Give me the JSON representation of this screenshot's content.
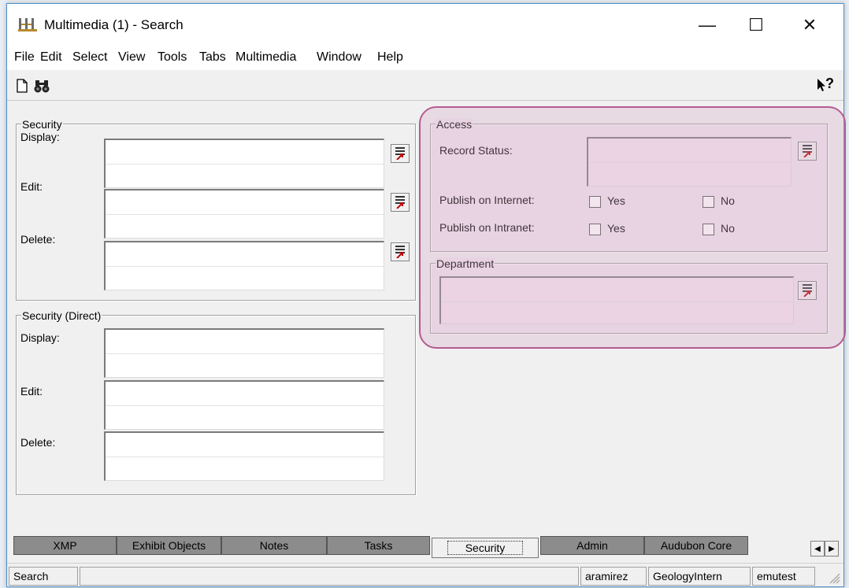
{
  "window": {
    "title": "Multimedia (1) - Search",
    "controls": {
      "minimize": "—",
      "maximize": "☐",
      "close": "✕"
    }
  },
  "menu": [
    "File",
    "Edit",
    "Select",
    "View",
    "Tools",
    "Tabs",
    "Multimedia",
    "Window",
    "Help"
  ],
  "toolbar": {
    "icons": [
      "new-document-icon",
      "binoculars-search-icon",
      "context-help-icon"
    ],
    "help_glyph": "?"
  },
  "security": {
    "legend": "Security",
    "display_label": "Display:",
    "edit_label": "Edit:",
    "delete_label": "Delete:"
  },
  "security_direct": {
    "legend": "Security (Direct)",
    "display_label": "Display:",
    "edit_label": "Edit:",
    "delete_label": "Delete:"
  },
  "access": {
    "legend": "Access",
    "record_status_label": "Record Status:",
    "publish_internet_label": "Publish on Internet:",
    "publish_intranet_label": "Publish on Intranet:",
    "yes_label": "Yes",
    "no_label": "No"
  },
  "department": {
    "legend": "Department"
  },
  "highlight_color": "#b45b92",
  "tabs": [
    {
      "label": "XMP",
      "active": false
    },
    {
      "label": "Exhibit Objects",
      "active": false
    },
    {
      "label": "Notes",
      "active": false
    },
    {
      "label": "Tasks",
      "active": false
    },
    {
      "label": "Security",
      "active": true
    },
    {
      "label": "Admin",
      "active": false
    },
    {
      "label": "Audubon Core",
      "active": false
    }
  ],
  "tab_scroll": {
    "left": "◀",
    "right": "▶"
  },
  "status": {
    "mode": "Search",
    "user": "aramirez",
    "group": "GeologyIntern",
    "server": "emutest"
  }
}
